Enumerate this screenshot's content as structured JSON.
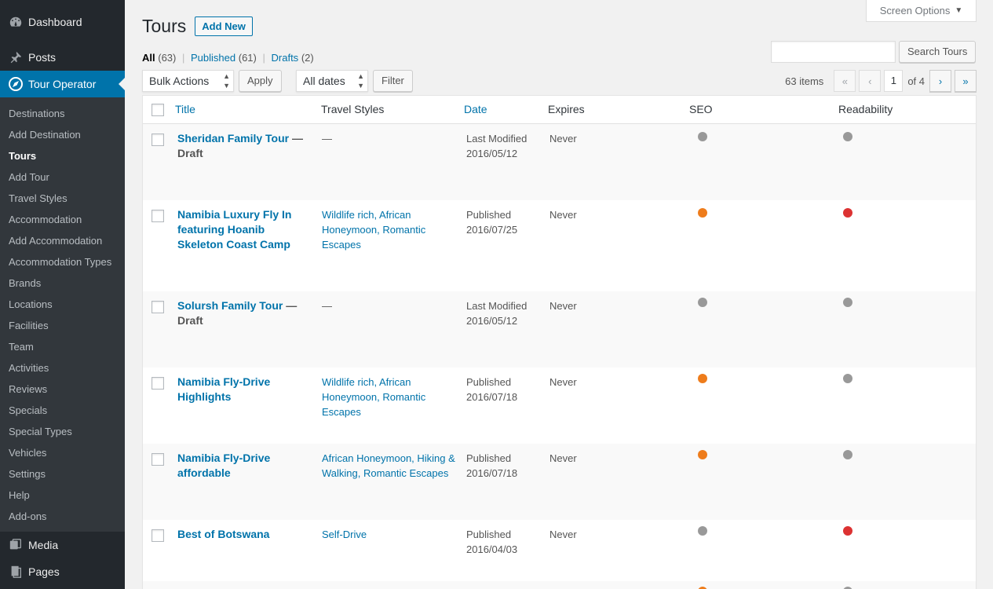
{
  "sidebar": {
    "top_items": [
      {
        "label": "Dashboard",
        "icon": "dashboard-icon"
      },
      {
        "label": "Posts",
        "icon": "pushpin-icon"
      },
      {
        "label": "Tour Operator",
        "icon": "compass-icon"
      }
    ],
    "submenu": [
      "Destinations",
      "Add Destination",
      "Tours",
      "Add Tour",
      "Travel Styles",
      "Accommodation",
      "Add Accommodation",
      "Accommodation Types",
      "Brands",
      "Locations",
      "Facilities",
      "Team",
      "Activities",
      "Reviews",
      "Specials",
      "Special Types",
      "Vehicles",
      "Settings",
      "Help",
      "Add-ons"
    ],
    "bottom_items": [
      {
        "label": "Media",
        "icon": "media-icon"
      },
      {
        "label": "Pages",
        "icon": "pages-icon"
      }
    ]
  },
  "header": {
    "screen_options": "Screen Options",
    "title": "Tours",
    "add_new": "Add New"
  },
  "filters": {
    "all": "All",
    "all_count": "(63)",
    "published": "Published",
    "published_count": "(61)",
    "drafts": "Drafts",
    "drafts_count": "(2)",
    "sep": "|"
  },
  "search": {
    "value": "",
    "button": "Search Tours"
  },
  "tablenav": {
    "bulk_actions": "Bulk Actions",
    "apply": "Apply",
    "dates": "All dates",
    "filter": "Filter",
    "items": "63 items",
    "first": "«",
    "prev": "‹",
    "page": "1",
    "of": "of 4",
    "next": "›",
    "last": "»"
  },
  "table": {
    "columns": {
      "title": "Title",
      "travel_styles": "Travel Styles",
      "date": "Date",
      "expires": "Expires",
      "seo": "SEO",
      "readability": "Readability"
    },
    "rows": [
      {
        "title": "Sheridan Family Tour",
        "state": " — Draft",
        "styles": "—",
        "styles_link": false,
        "date_status": "Last Modified",
        "date": "2016/05/12",
        "expires": "Never",
        "seo": "gray",
        "readability": "gray"
      },
      {
        "title": "Namibia Luxury Fly In featuring Hoanib Skeleton Coast Camp",
        "state": "",
        "styles": "Wildlife rich, African Honeymoon, Romantic Escapes",
        "styles_link": true,
        "date_status": "Published",
        "date": "2016/07/25",
        "expires": "Never",
        "seo": "orange",
        "readability": "red"
      },
      {
        "title": "Solursh Family Tour",
        "state": " — Draft",
        "styles": "—",
        "styles_link": false,
        "date_status": "Last Modified",
        "date": "2016/05/12",
        "expires": "Never",
        "seo": "gray",
        "readability": "gray"
      },
      {
        "title": "Namibia Fly-Drive Highlights",
        "state": "",
        "styles": "Wildlife rich, African Honeymoon, Romantic Escapes",
        "styles_link": true,
        "date_status": "Published",
        "date": "2016/07/18",
        "expires": "Never",
        "seo": "orange",
        "readability": "gray"
      },
      {
        "title": "Namibia Fly-Drive affordable",
        "state": "",
        "styles": "African Honeymoon, Hiking & Walking, Romantic Escapes",
        "styles_link": true,
        "date_status": "Published",
        "date": "2016/07/18",
        "expires": "Never",
        "seo": "orange",
        "readability": "gray"
      },
      {
        "title": "Best of Botswana",
        "state": "",
        "styles": "Self-Drive",
        "styles_link": true,
        "date_status": "Published",
        "date": "2016/04/03",
        "expires": "Never",
        "seo": "gray",
        "readability": "red"
      }
    ]
  },
  "colors": {
    "sidebar_bg": "#23282d",
    "accent": "#0073aa",
    "dot_gray": "#999999",
    "dot_orange": "#ee7c1b",
    "dot_red": "#dc3232"
  }
}
